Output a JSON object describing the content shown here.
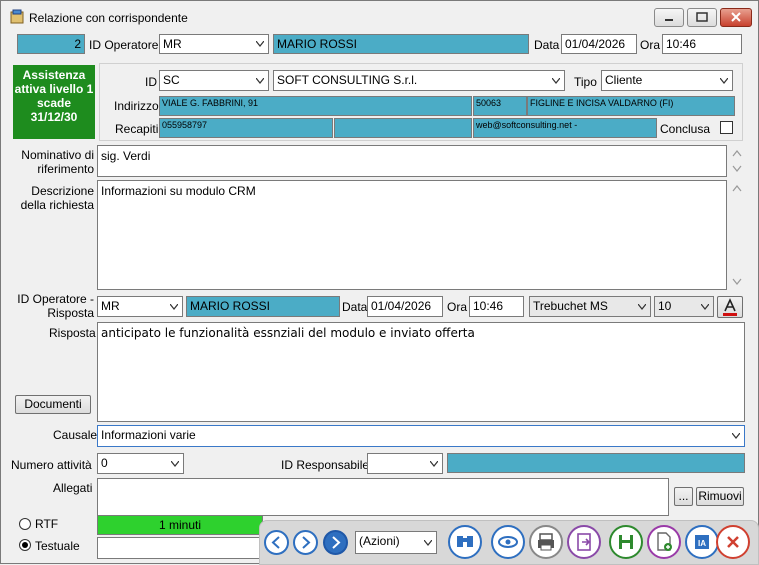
{
  "window": {
    "title": "Relazione con corrispondente"
  },
  "header": {
    "record_number": "2",
    "id_operatore_label": "ID Operatore",
    "id_operatore_value": "MR",
    "operatore_name": "MARIO ROSSI",
    "data_label": "Data",
    "data_value": "01/04/2026",
    "ora_label": "Ora",
    "ora_value": "10:46"
  },
  "assistance_badge": {
    "text": "Assistenza attiva livello 1 scade 31/12/30",
    "color": "#1e8c1e"
  },
  "contact": {
    "id_label": "ID",
    "id_value": "SC",
    "company": "SOFT CONSULTING S.r.l.",
    "tipo_label": "Tipo",
    "tipo_value": "Cliente",
    "indirizzo_label": "Indirizzo",
    "address": "VIALE G. FABBRINI, 91",
    "cap": "50063",
    "city": "FIGLINE E INCISA VALDARNO (FI)",
    "recapiti_label": "Recapiti",
    "phone": "055958797",
    "phone2": "",
    "email": "web@softconsulting.net -",
    "conclusa_label": "Conclusa"
  },
  "request": {
    "nominativo_label": "Nominativo di riferimento",
    "nominativo_value": "sig. Verdi",
    "descrizione_label": "Descrizione della richiesta",
    "descrizione_value": "Informazioni su modulo CRM"
  },
  "response": {
    "id_operatore_risposta_label": "ID Operatore - Risposta",
    "id_operatore_value": "MR",
    "operatore_name": "MARIO ROSSI",
    "data_label": "Data",
    "data_value": "01/04/2026",
    "ora_label": "Ora",
    "ora_value": "10:46",
    "font_name": "Trebuchet MS",
    "font_size": "10",
    "risposta_label": "Risposta",
    "risposta_value": "anticipato le funzionalità essnziali del modulo e inviato offerta",
    "documenti_button": "Documenti"
  },
  "details": {
    "causale_label": "Causale",
    "causale_value": "Informazioni varie",
    "numero_attivita_label": "Numero attività",
    "numero_attivita_value": "0",
    "id_responsabile_label": "ID Responsabile",
    "id_responsabile_value": "",
    "allegati_label": "Allegati",
    "browse_button": "...",
    "rimuovi_button": "Rimuovi"
  },
  "format": {
    "rtf_label": "RTF",
    "testuale_label": "Testuale",
    "selected": "Testuale",
    "timer_text": "1 minuti",
    "timer_fraction": 1.0
  },
  "toolbar": {
    "azioni_label": "(Azioni)",
    "icons": [
      "prev-icon",
      "next-icon",
      "next-filled-icon",
      "binoculars-icon",
      "eye-icon",
      "print-icon",
      "export-icon",
      "save-icon",
      "new-doc-icon",
      "ai-icon",
      "close-icon"
    ]
  },
  "colors": {
    "teal": "#4bacc6",
    "green": "#1e8c1e",
    "progress": "#2ed12e"
  }
}
